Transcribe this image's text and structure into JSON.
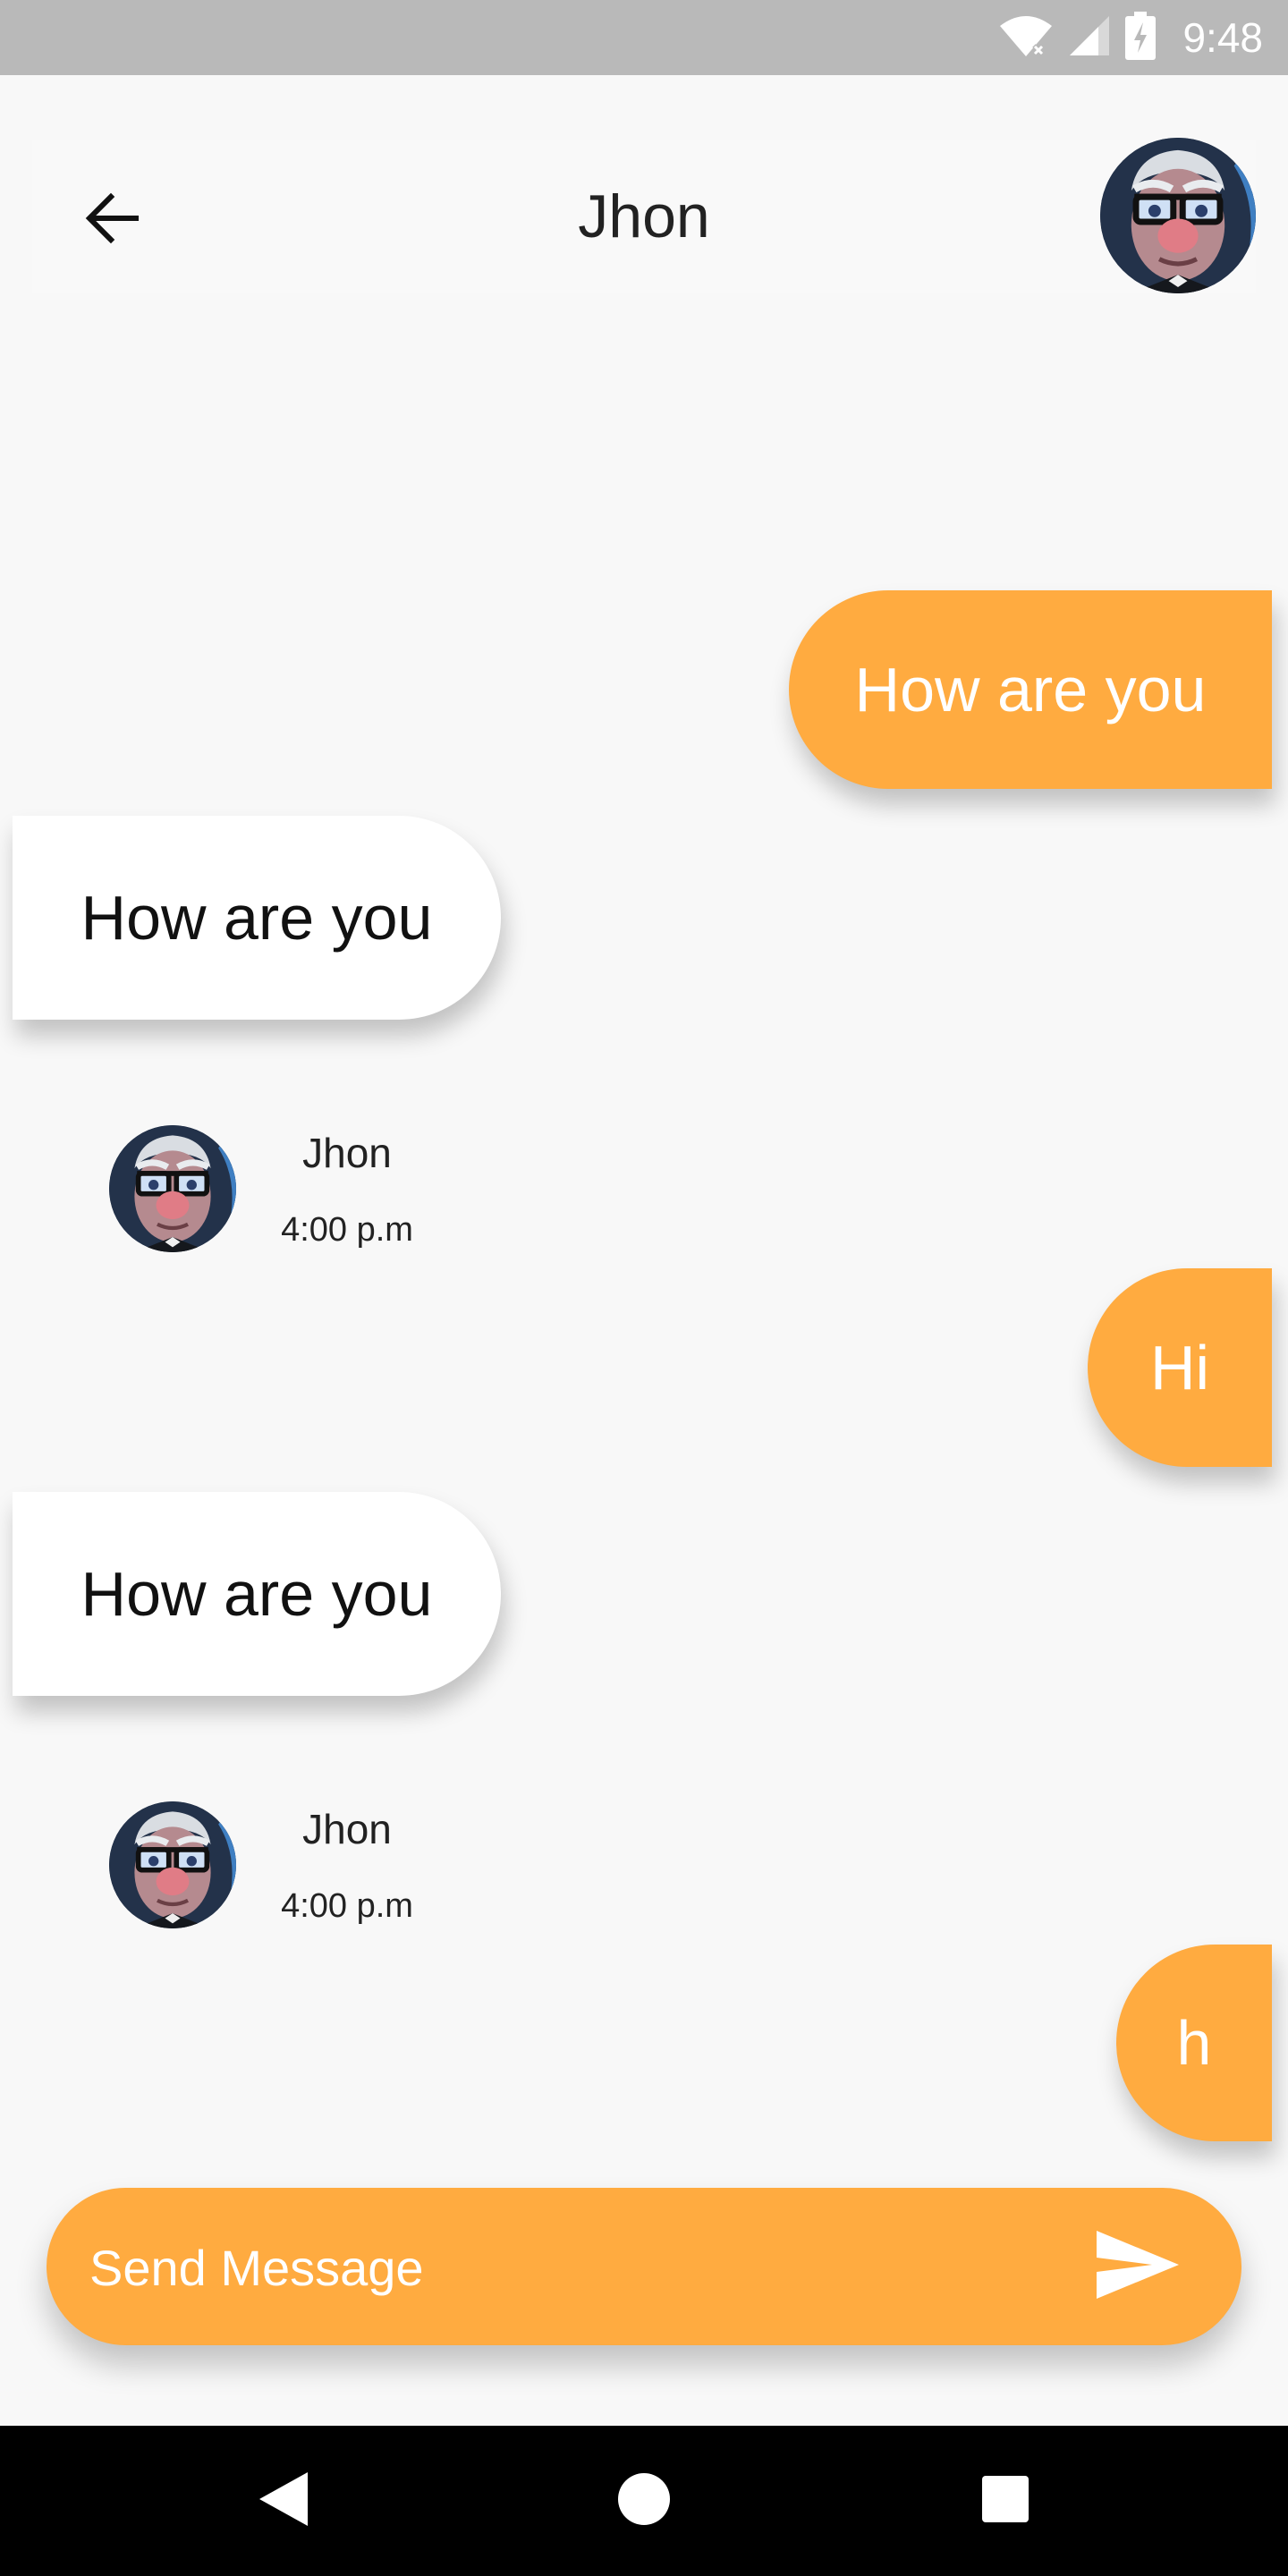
{
  "status_bar": {
    "time": "9:48",
    "icons": [
      "wifi-icon",
      "signal-icon",
      "battery-icon"
    ]
  },
  "header": {
    "title": "Jhon",
    "back_icon": "arrow-left-icon",
    "avatar": "contact-avatar"
  },
  "messages": [
    {
      "type": "sent",
      "text": "How are you"
    },
    {
      "type": "received",
      "text": "How are you",
      "sender": "Jhon",
      "time": "4:00 p.m"
    },
    {
      "type": "sent",
      "text": "Hi"
    },
    {
      "type": "received",
      "text": "How are you",
      "sender": "Jhon",
      "time": "4:00 p.m"
    },
    {
      "type": "sent",
      "text": "h"
    }
  ],
  "composer": {
    "placeholder": "Send Message",
    "value": "",
    "send_icon": "send-icon"
  },
  "nav_bar": {
    "icons": [
      "back-triangle-icon",
      "home-circle-icon",
      "recents-square-icon"
    ]
  },
  "colors": {
    "accent": "#ffab40",
    "background": "#f8f8f8",
    "status_bar": "#b9b9b9",
    "received_bubble": "#ffffff"
  }
}
